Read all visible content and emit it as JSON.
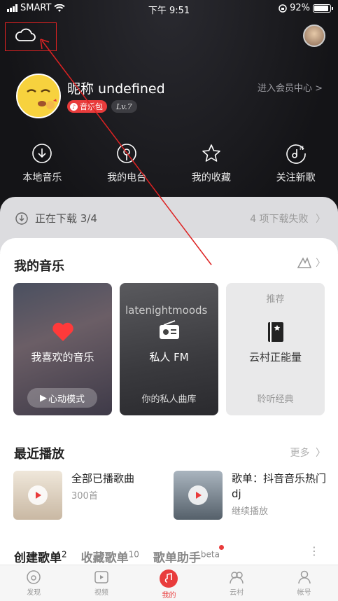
{
  "status_bar": {
    "carrier": "SMART",
    "time": "下午 9:51",
    "battery": "92%",
    "battery_level": 0.92
  },
  "profile": {
    "nickname": "昵称 undefined",
    "vip_badge": "音乐包",
    "level": "Lv.7",
    "member_center": "进入会员中心 >"
  },
  "quick_actions": [
    {
      "label": "本地音乐",
      "icon": "download-circle-icon"
    },
    {
      "label": "我的电台",
      "icon": "radio-icon"
    },
    {
      "label": "我的收藏",
      "icon": "star-icon"
    },
    {
      "label": "关注新歌",
      "icon": "new-songs-icon"
    }
  ],
  "download_bar": {
    "label": "正在下载 3/4",
    "failed": "4 项下载失败"
  },
  "my_music": {
    "title": "我的音乐",
    "cards": [
      {
        "label": "我喜欢的音乐",
        "button": "心动模式"
      },
      {
        "label": "私人 FM",
        "sub": "你的私人曲库",
        "art_text": "latenightmoods"
      },
      {
        "top": "推荐",
        "label": "云村正能量",
        "sub": "聆听经典"
      }
    ]
  },
  "recent": {
    "title": "最近播放",
    "more": "更多",
    "items": [
      {
        "title": "全部已播歌曲",
        "sub": "300首"
      },
      {
        "title": "歌单：抖音音乐热门 dj",
        "sub": "继续播放"
      }
    ]
  },
  "playlist_tabs": [
    {
      "label": "创建歌单",
      "count": "2"
    },
    {
      "label": "收藏歌单",
      "count": "10"
    },
    {
      "label": "歌单助手",
      "count": "beta"
    }
  ],
  "tabbar": [
    {
      "label": "发现",
      "icon": "discover-icon",
      "active": false
    },
    {
      "label": "视频",
      "icon": "video-icon",
      "active": false
    },
    {
      "label": "我的",
      "icon": "music-note-icon",
      "active": true
    },
    {
      "label": "云村",
      "icon": "community-icon",
      "active": false
    },
    {
      "label": "帐号",
      "icon": "account-icon",
      "active": false
    }
  ],
  "colors": {
    "accent": "#e93c3c",
    "annotation": "#d22222"
  }
}
